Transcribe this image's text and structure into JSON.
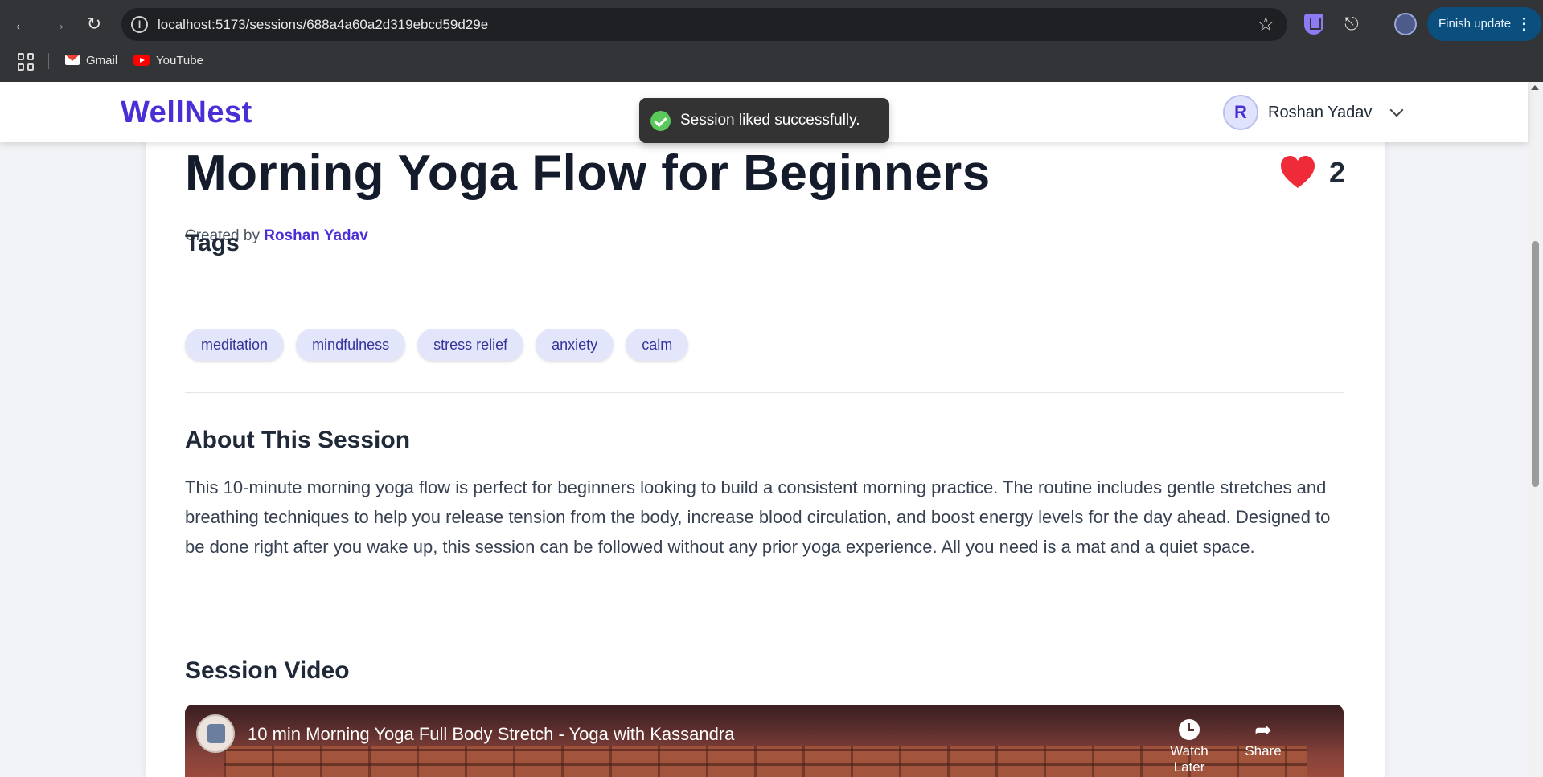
{
  "browser": {
    "url": "localhost:5173/sessions/688a4a60a2d319ebcd59d29e",
    "finish_update_label": "Finish update",
    "bookmarks": [
      {
        "label": "Gmail"
      },
      {
        "label": "YouTube"
      }
    ]
  },
  "header": {
    "brand": "WellNest",
    "user_initial": "R",
    "user_name": "Roshan Yadav"
  },
  "toast": {
    "message": "Session liked successfully."
  },
  "session": {
    "title": "Morning Yoga Flow for Beginners",
    "like_count": "2",
    "created_by_prefix": "Created by",
    "author": "Roshan Yadav",
    "tags_heading": "Tags",
    "tags": [
      "meditation",
      "mindfulness",
      "stress relief",
      "anxiety",
      "calm"
    ],
    "about_heading": "About This Session",
    "about_text": "This 10-minute morning yoga flow is perfect for beginners looking to build a consistent morning practice. The routine includes gentle stretches and breathing techniques to help you release tension from the body, increase blood circulation, and boost energy levels for the day ahead. Designed to be done right after you wake up, this session can be followed without any prior yoga experience. All you need is a mat and a quiet space.",
    "video_heading": "Session Video",
    "video": {
      "title": "10 min Morning Yoga Full Body Stretch - Yoga with Kassandra",
      "watch_later_label": "Watch Later",
      "share_label": "Share"
    }
  },
  "colors": {
    "brand": "#4a2fd6",
    "heart": "#ef2b3a",
    "tag_bg": "#e3e6fb",
    "toast_success": "#5bc85b"
  }
}
